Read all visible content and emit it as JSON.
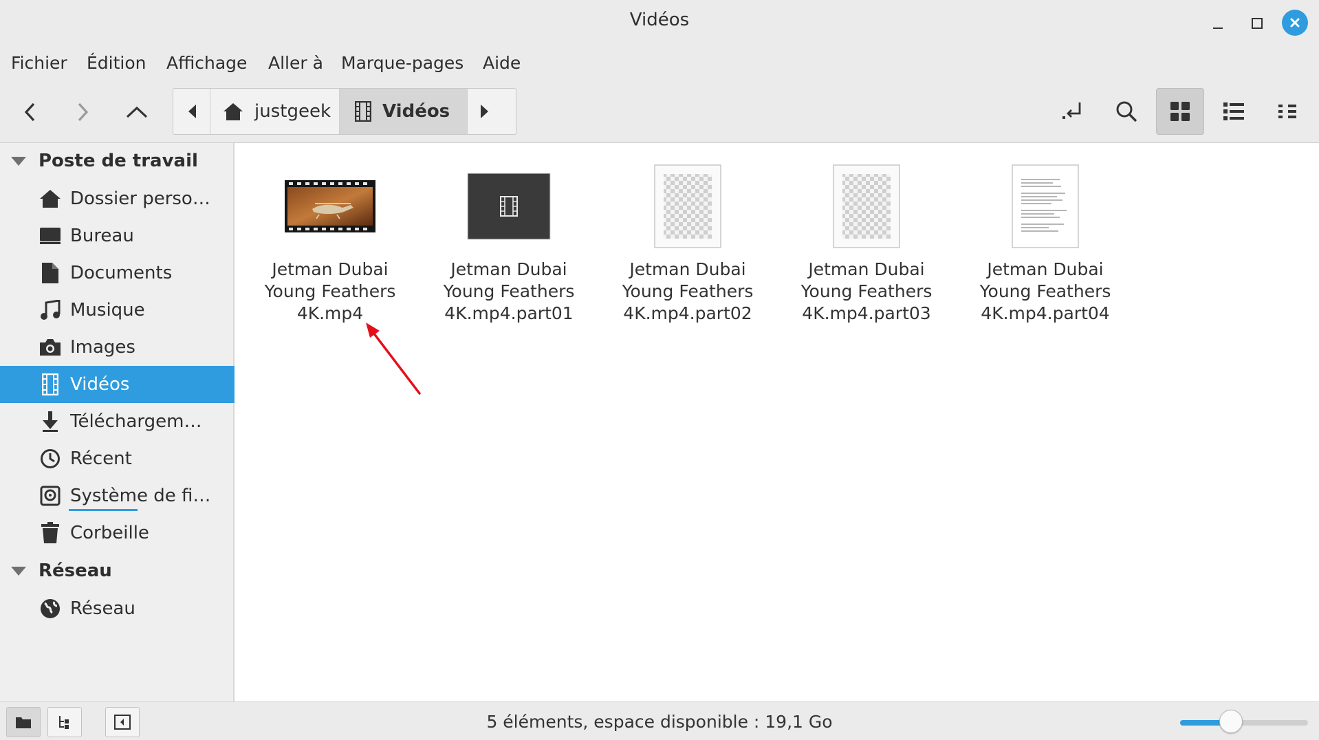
{
  "window": {
    "title": "Vidéos"
  },
  "menu": [
    "Fichier",
    "Édition",
    "Affichage",
    "Aller à",
    "Marque-pages",
    "Aide"
  ],
  "pathbar": {
    "home": "justgeek",
    "current": "Vidéos"
  },
  "sidebar": {
    "sections": [
      {
        "title": "Poste de travail",
        "items": [
          {
            "label": "Dossier perso…",
            "icon": "home-icon"
          },
          {
            "label": "Bureau",
            "icon": "desktop-icon"
          },
          {
            "label": "Documents",
            "icon": "document-icon"
          },
          {
            "label": "Musique",
            "icon": "music-icon"
          },
          {
            "label": "Images",
            "icon": "camera-icon"
          },
          {
            "label": "Vidéos",
            "icon": "film-icon",
            "selected": true
          },
          {
            "label": "Téléchargem…",
            "icon": "download-icon"
          },
          {
            "label": "Récent",
            "icon": "clock-icon"
          },
          {
            "label": "Système de fi…",
            "icon": "filesystem-icon",
            "usage_fraction": 0.45
          },
          {
            "label": "Corbeille",
            "icon": "trash-icon"
          }
        ]
      },
      {
        "title": "Réseau",
        "items": [
          {
            "label": "Réseau",
            "icon": "network-icon"
          }
        ]
      }
    ]
  },
  "files": [
    {
      "line1": "Jetman Dubai",
      "line2": "Young Feathers",
      "line3": "4K.mp4",
      "thumb": "video-thumbnail"
    },
    {
      "line1": "Jetman Dubai",
      "line2": "Young Feathers",
      "line3": "4K.mp4.part01",
      "thumb": "video-file-icon"
    },
    {
      "line1": "Jetman Dubai",
      "line2": "Young Feathers",
      "line3": "4K.mp4.part02",
      "thumb": "image-file-icon"
    },
    {
      "line1": "Jetman Dubai",
      "line2": "Young Feathers",
      "line3": "4K.mp4.part03",
      "thumb": "image-file-icon"
    },
    {
      "line1": "Jetman Dubai",
      "line2": "Young Feathers",
      "line3": "4K.mp4.part04",
      "thumb": "text-file-icon"
    }
  ],
  "status": {
    "text": "5 éléments, espace disponible : 19,1 Go",
    "zoom_level": 0.4
  },
  "colors": {
    "accent": "#2e9cde",
    "annotation_arrow": "#e3101a"
  }
}
